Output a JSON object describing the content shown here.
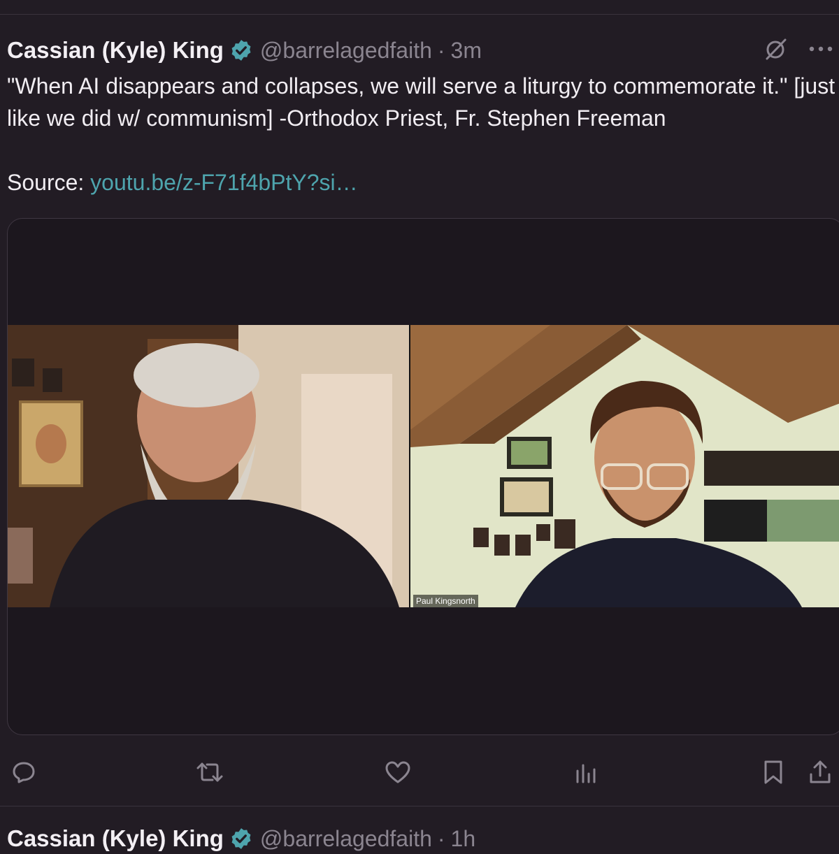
{
  "tweet": {
    "author": "Cassian (Kyle) King",
    "handle": "@barrelagedfaith",
    "separator": "·",
    "time": "3m",
    "text": "\"When AI disappears and collapses, we will serve a liturgy to commemorate it.\" [just like we did w/ communism]  -Orthodox Priest, Fr. Stephen Freeman",
    "source_label": "Source: ",
    "source_link": "youtu.be/z-F71f4bPtY?si…",
    "video_name_tag": "Paul Kingsnorth"
  },
  "next_tweet": {
    "author": "Cassian (Kyle) King",
    "handle": "@barrelagedfaith",
    "separator": "·",
    "time": "1h"
  },
  "icons": {
    "verified": "verified-badge-icon",
    "grok": "grok-icon",
    "more": "more-icon",
    "reply": "reply-icon",
    "retweet": "retweet-icon",
    "like": "like-icon",
    "views": "views-icon",
    "bookmark": "bookmark-icon",
    "share": "share-icon"
  },
  "colors": {
    "background": "#221c24",
    "text": "#f1edf2",
    "muted": "#8b8590",
    "link": "#4ea4ad",
    "verified": "#4ea4ad"
  }
}
